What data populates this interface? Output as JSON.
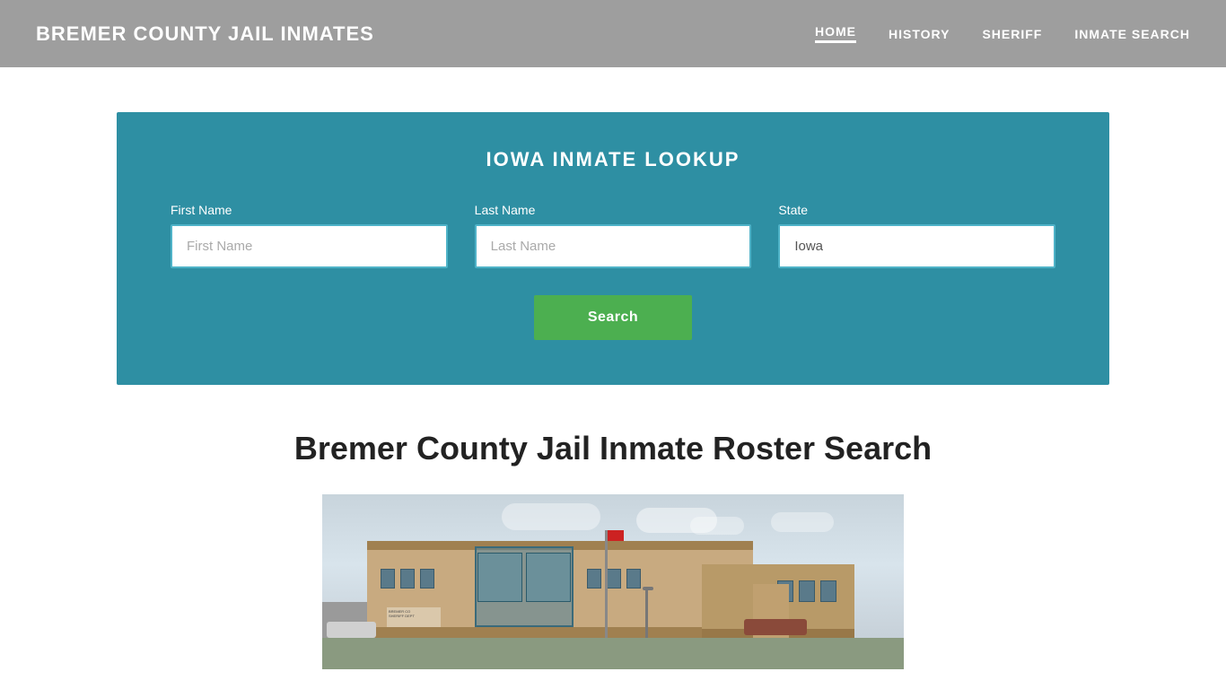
{
  "header": {
    "site_title": "BREMER COUNTY JAIL INMATES",
    "nav": [
      {
        "label": "HOME",
        "active": true
      },
      {
        "label": "HISTORY",
        "active": false
      },
      {
        "label": "SHERIFF",
        "active": false
      },
      {
        "label": "INMATE SEARCH",
        "active": false
      }
    ]
  },
  "search_section": {
    "title": "IOWA INMATE LOOKUP",
    "fields": {
      "first_name": {
        "label": "First Name",
        "placeholder": "First Name"
      },
      "last_name": {
        "label": "Last Name",
        "placeholder": "Last Name"
      },
      "state": {
        "label": "State",
        "value": "Iowa"
      }
    },
    "search_button_label": "Search"
  },
  "main_content": {
    "page_heading": "Bremer County Jail Inmate Roster Search"
  }
}
